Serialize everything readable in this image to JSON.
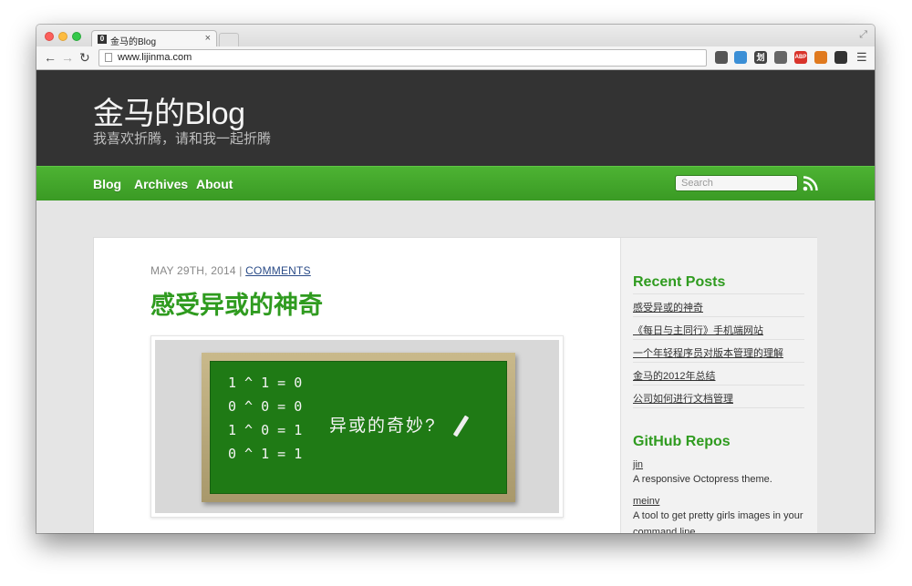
{
  "browser": {
    "tab_title": "金马的Blog",
    "tab_favicon_letter": "0",
    "tab_close_glyph": "×",
    "address": "www.lijinma.com",
    "extensions": [
      {
        "name": "pocket-icon",
        "color": "#555555",
        "label": ""
      },
      {
        "name": "page-translate-icon",
        "color": "#3b8fd6",
        "label": ""
      },
      {
        "name": "dictionary-icon",
        "color": "#444444",
        "label": "划"
      },
      {
        "name": "screenshot-icon",
        "color": "#666666",
        "label": ""
      },
      {
        "name": "adblock-icon",
        "color": "#d9342b",
        "label": "ABP"
      },
      {
        "name": "color-picker-icon",
        "color": "#e07a1f",
        "label": ""
      },
      {
        "name": "clock-icon",
        "color": "#333333",
        "label": ""
      }
    ],
    "menu_glyph": "☰"
  },
  "site": {
    "title": "金马的Blog",
    "subtitle": "我喜欢折腾，请和我一起折腾",
    "nav": [
      "Blog",
      "Archives",
      "About"
    ],
    "search_placeholder": "Search",
    "accent": "#3fa528"
  },
  "post": {
    "date": "MAY 29TH, 2014",
    "separator": "|",
    "comments_label": "COMMENTS",
    "title": "感受异或的神奇",
    "image": {
      "lines": [
        "1 ^ 1 = 0",
        "0 ^ 0 = 0",
        "1 ^ 0 = 1",
        "0 ^ 1 = 1"
      ],
      "caption": "异或的奇妙?"
    }
  },
  "sidebar": {
    "recent_title": "Recent Posts",
    "recent_posts": [
      "感受异或的神奇",
      "《每日与主同行》手机端网站",
      "一个年轻程序员对版本管理的理解",
      "金马的2012年总结",
      "公司如何进行文档管理"
    ],
    "github_title": "GitHub Repos",
    "repos": [
      {
        "name": "jin",
        "description": "A responsive Octopress theme."
      },
      {
        "name": "meinv",
        "description": "A tool to get pretty girls images in your command line"
      }
    ]
  }
}
